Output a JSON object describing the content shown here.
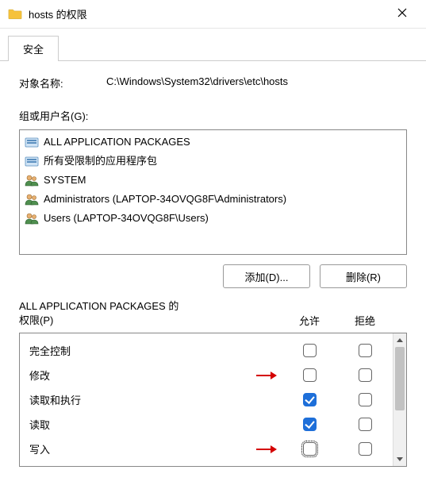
{
  "window": {
    "title": "hosts 的权限"
  },
  "tabs": {
    "security": "安全"
  },
  "object": {
    "label": "对象名称:",
    "value": "C:\\Windows\\System32\\drivers\\etc\\hosts"
  },
  "groups": {
    "label": "组或用户名(G):",
    "items": [
      {
        "icon": "package",
        "text": "ALL APPLICATION PACKAGES"
      },
      {
        "icon": "package",
        "text": "所有受限制的应用程序包"
      },
      {
        "icon": "users",
        "text": "SYSTEM"
      },
      {
        "icon": "users",
        "text": "Administrators (LAPTOP-34OVQG8F\\Administrators)"
      },
      {
        "icon": "users",
        "text": "Users (LAPTOP-34OVQG8F\\Users)"
      }
    ]
  },
  "buttons": {
    "add": "添加(D)...",
    "remove": "删除(R)"
  },
  "permissions": {
    "title_prefix": "ALL APPLICATION PACKAGES 的",
    "title_suffix": "权限(P)",
    "col_allow": "允许",
    "col_deny": "拒绝",
    "rows": [
      {
        "name": "完全控制",
        "allow": false,
        "deny": false,
        "arrow": false,
        "focus": false
      },
      {
        "name": "修改",
        "allow": false,
        "deny": false,
        "arrow": true,
        "focus": false
      },
      {
        "name": "读取和执行",
        "allow": true,
        "deny": false,
        "arrow": false,
        "focus": false
      },
      {
        "name": "读取",
        "allow": true,
        "deny": false,
        "arrow": false,
        "focus": false
      },
      {
        "name": "写入",
        "allow": false,
        "deny": false,
        "arrow": true,
        "focus": true
      }
    ]
  }
}
